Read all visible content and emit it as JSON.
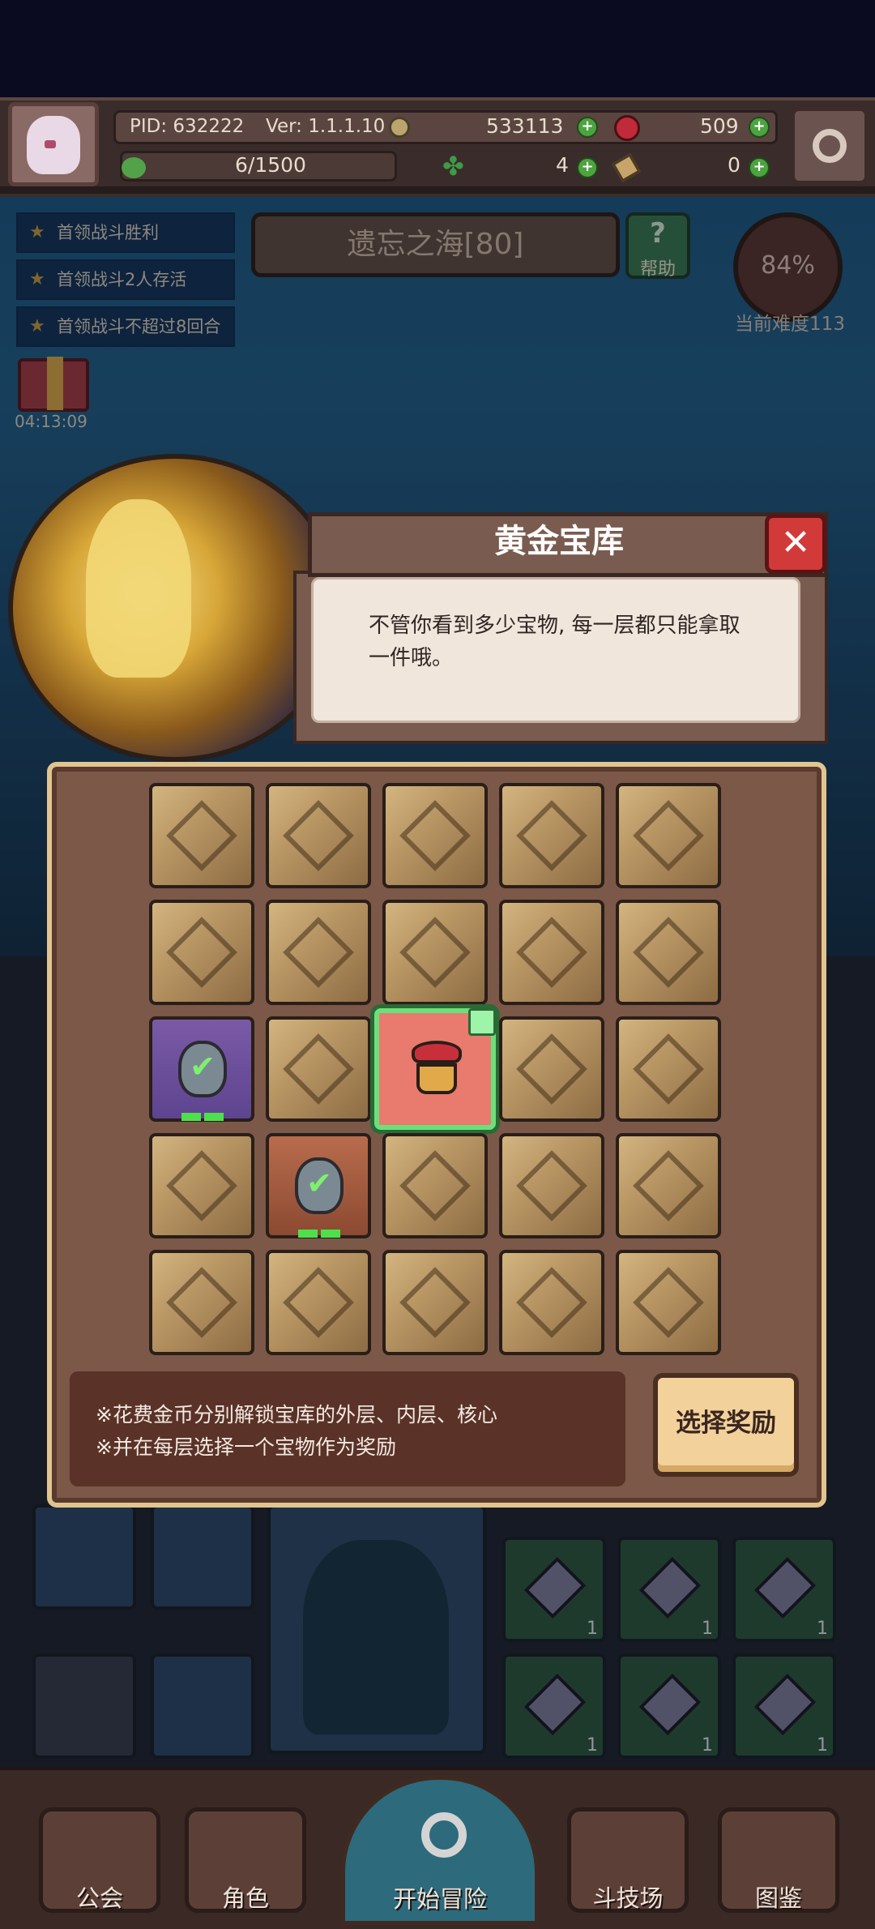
{
  "header": {
    "pid": "PID: 632222",
    "version": "Ver: 1.1.1.10",
    "gold": "533113",
    "gems": "509",
    "stamina": "6/1500",
    "clover": "4",
    "keys": "0"
  },
  "quests": [
    {
      "label": "首领战斗胜利"
    },
    {
      "label": "首领战斗2人存活"
    },
    {
      "label": "首领战斗不超过8回合"
    }
  ],
  "stage": {
    "title": "遗忘之海[80]",
    "help_label": "帮助",
    "difficulty_percent": "84%",
    "difficulty_label": "当前难度113"
  },
  "gift": {
    "timer": "04:13:09"
  },
  "dialog": {
    "title": "黄金宝库",
    "text": "不管你看到多少宝物, 每一层都只能拿取一件哦。"
  },
  "vault": {
    "notes": [
      "※花费金币分别解锁宝库的外层、内层、核心",
      "※并在每层选择一个宝物作为奖励"
    ],
    "choose_button": "选择奖励"
  },
  "background_grid": {
    "counts": [
      "1",
      "1",
      "1",
      "1",
      "1",
      "1"
    ]
  },
  "nav": {
    "guild": "公会",
    "character": "角色",
    "adventure": "开始冒险",
    "arena": "斗技场",
    "codex": "图鉴"
  },
  "colors": {
    "accent_gold": "#e2c48f",
    "close_red": "#d23a3a",
    "selected_green": "#6be07a"
  }
}
